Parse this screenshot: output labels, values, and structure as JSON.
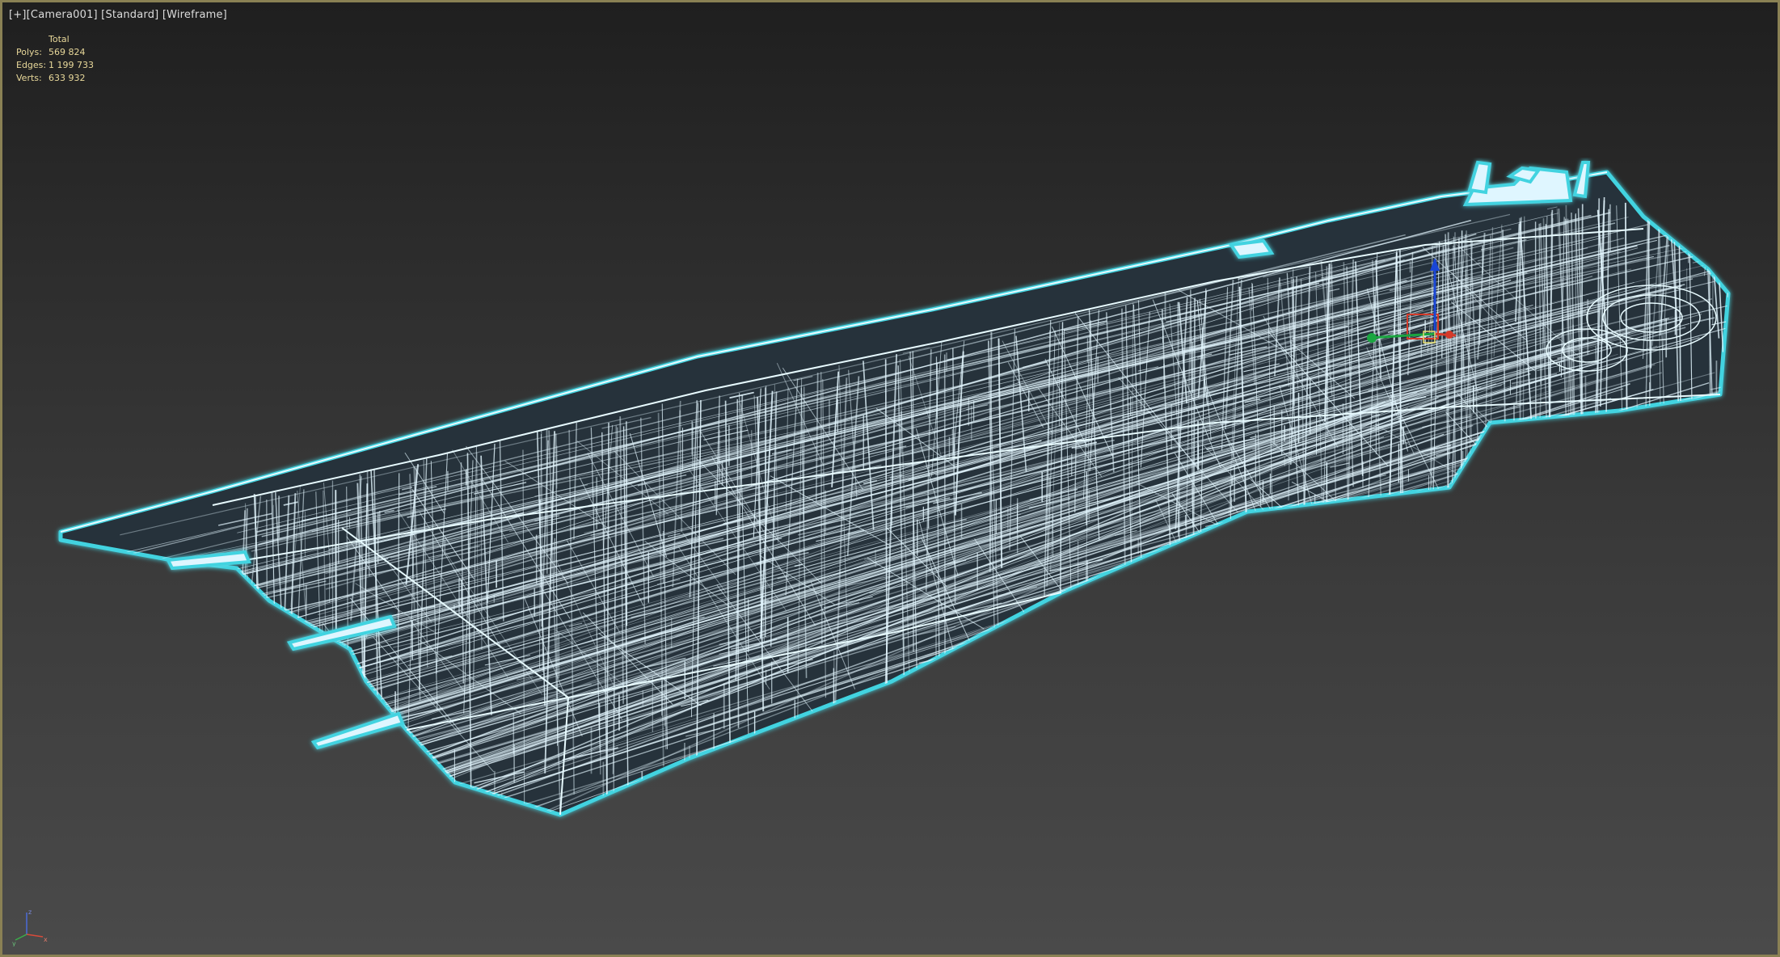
{
  "viewport": {
    "labels": [
      "[+]",
      "[Camera001]",
      "[Standard]",
      "[Wireframe]"
    ],
    "border_color": "#8a8154",
    "wire_color": "#e4f7ff",
    "wire_glow_color": "#43d3e0"
  },
  "stats": {
    "header": "Total",
    "rows": [
      {
        "label": "Polys:",
        "value": "569 824"
      },
      {
        "label": "Edges:",
        "value": "1 199 733"
      },
      {
        "label": "Verts:",
        "value": "633 932"
      }
    ],
    "color": "#e8d89a"
  },
  "gizmo": {
    "x_color": "#d43a2a",
    "y_color": "#1aa640",
    "z_color": "#1a46d6"
  },
  "axis_tripod": {
    "x_label": "x",
    "y_label": "y",
    "z_label": "z"
  },
  "icons": [
    "move-gizmo-icon",
    "axis-tripod-icon"
  ]
}
